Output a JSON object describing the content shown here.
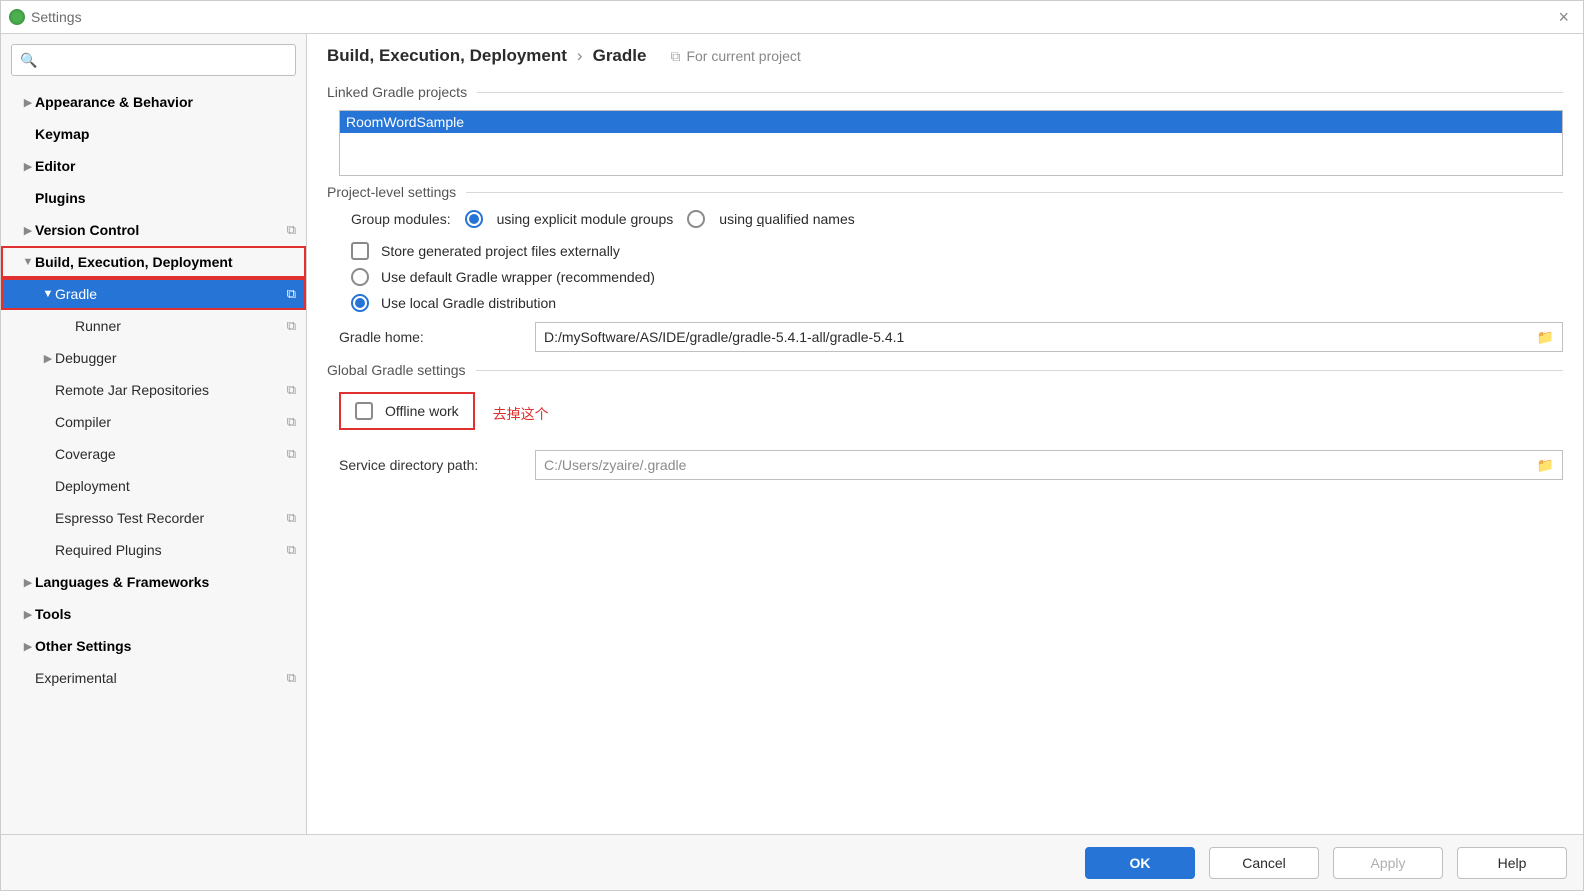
{
  "window": {
    "title": "Settings"
  },
  "breadcrumb": {
    "parent": "Build, Execution, Deployment",
    "current": "Gradle",
    "note": "For current project"
  },
  "sidebar": {
    "items": [
      {
        "label": "Appearance & Behavior",
        "bold": true,
        "level": 0,
        "chev": "▶"
      },
      {
        "label": "Keymap",
        "bold": true,
        "level": 0
      },
      {
        "label": "Editor",
        "bold": true,
        "level": 0,
        "chev": "▶"
      },
      {
        "label": "Plugins",
        "bold": true,
        "level": 0
      },
      {
        "label": "Version Control",
        "bold": true,
        "level": 0,
        "chev": "▶",
        "copy": true
      },
      {
        "label": "Build, Execution, Deployment",
        "bold": true,
        "level": 0,
        "chev": "▼",
        "redbox": true
      },
      {
        "label": "Gradle",
        "level": 1,
        "chev": "▼",
        "selected": true,
        "redbox": true,
        "copy": true
      },
      {
        "label": "Runner",
        "level": 2,
        "copy": true
      },
      {
        "label": "Debugger",
        "level": 1,
        "chev": "▶"
      },
      {
        "label": "Remote Jar Repositories",
        "level": 1,
        "copy": true
      },
      {
        "label": "Compiler",
        "level": 1,
        "copy": true
      },
      {
        "label": "Coverage",
        "level": 1,
        "copy": true
      },
      {
        "label": "Deployment",
        "level": 1
      },
      {
        "label": "Espresso Test Recorder",
        "level": 1,
        "copy": true
      },
      {
        "label": "Required Plugins",
        "level": 1,
        "copy": true
      },
      {
        "label": "Languages & Frameworks",
        "bold": true,
        "level": 0,
        "chev": "▶"
      },
      {
        "label": "Tools",
        "bold": true,
        "level": 0,
        "chev": "▶"
      },
      {
        "label": "Other Settings",
        "bold": true,
        "level": 0,
        "chev": "▶"
      },
      {
        "label": "Experimental",
        "level": 0,
        "copy": true
      }
    ]
  },
  "sections": {
    "linked": {
      "title": "Linked Gradle projects",
      "project": "RoomWordSample"
    },
    "projectLevel": {
      "title": "Project-level settings",
      "groupLabel": "Group modules:",
      "radio1": {
        "pre": "using explicit module ",
        "u": "g",
        "post": "roups"
      },
      "radio2": {
        "pre": "using ",
        "u": "q",
        "post": "ualified names"
      },
      "storeExt": "Store generated project files externally",
      "useDefault": "Use default Gradle wrapper (recommended)",
      "useLocal": "Use local Gradle distribution",
      "gradleHomeLabel": "Gradle home:",
      "gradleHomeValue": "D:/mySoftware/AS/IDE/gradle/gradle-5.4.1-all/gradle-5.4.1"
    },
    "global": {
      "title": "Global Gradle settings",
      "offline": "Offline work",
      "note": "去掉这个",
      "servicePathLabel": "Service directory path:",
      "servicePathValue": "C:/Users/zyaire/.gradle"
    }
  },
  "buttons": {
    "ok": "OK",
    "cancel": "Cancel",
    "apply": "Apply",
    "help": "Help"
  }
}
